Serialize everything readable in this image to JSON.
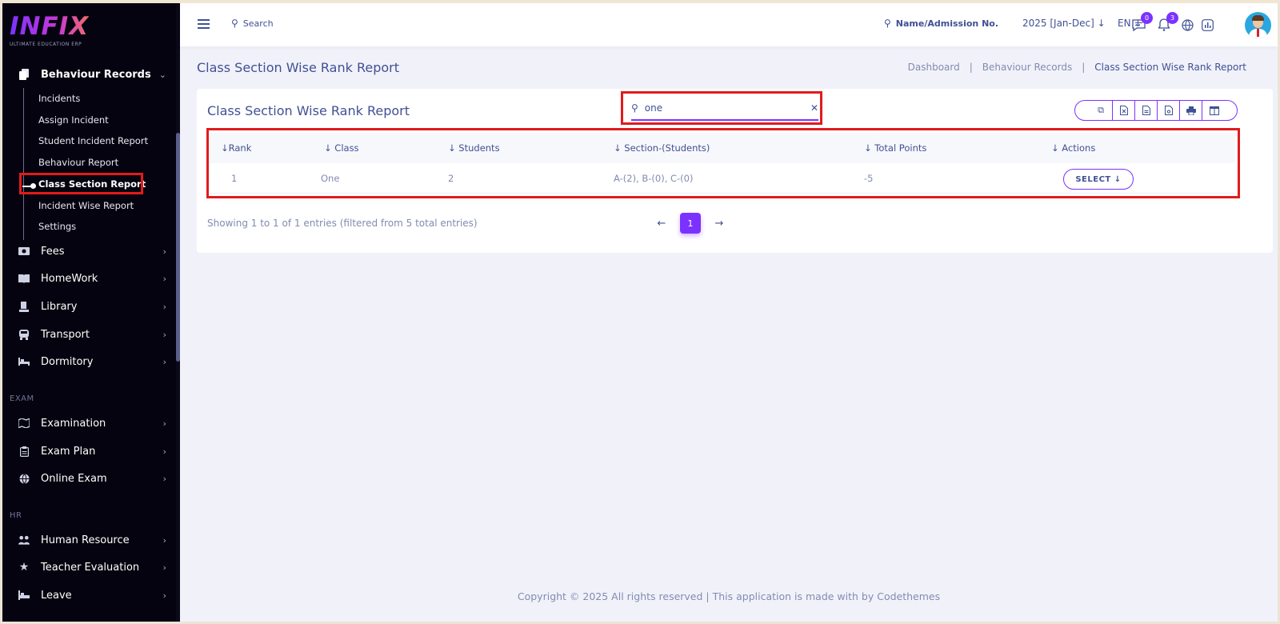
{
  "brand": {
    "logo": "INFIX",
    "tagline": "ULTIMATE EDUCATION ERP",
    "accent": "#7c32ff",
    "highlight": "#e11b1b"
  },
  "sidebar": {
    "behaviour": {
      "label": "Behaviour Records",
      "items": [
        {
          "label": "Incidents"
        },
        {
          "label": "Assign Incident"
        },
        {
          "label": "Student Incident Report"
        },
        {
          "label": "Behaviour Report"
        },
        {
          "label": "Class Section Report",
          "active": true
        },
        {
          "label": "Incident Wise Report"
        },
        {
          "label": "Settings"
        }
      ]
    },
    "menu": [
      {
        "label": "Fees",
        "icon": "money-icon"
      },
      {
        "label": "HomeWork",
        "icon": "book-icon"
      },
      {
        "label": "Library",
        "icon": "library-icon"
      },
      {
        "label": "Transport",
        "icon": "bus-icon"
      },
      {
        "label": "Dormitory",
        "icon": "bed-icon"
      }
    ],
    "exam_head": "EXAM",
    "exam_menu": [
      {
        "label": "Examination",
        "icon": "map-icon"
      },
      {
        "label": "Exam Plan",
        "icon": "clipboard-icon"
      },
      {
        "label": "Online Exam",
        "icon": "globe-icon"
      }
    ],
    "hr_head": "HR",
    "hr_menu": [
      {
        "label": "Human Resource",
        "icon": "users-icon"
      },
      {
        "label": "Teacher Evaluation",
        "icon": "star-icon"
      },
      {
        "label": "Leave",
        "icon": "leave-icon"
      }
    ]
  },
  "header": {
    "search_label": "Search",
    "name_search_label": "Name/Admission No.",
    "year": "2025 [Jan-Dec]",
    "language": "EN",
    "chat_count": "0",
    "notification_count": "3"
  },
  "page": {
    "title": "Class Section Wise Rank Report",
    "breadcrumb": [
      "Dashboard",
      "Behaviour Records",
      "Class Section Wise Rank Report"
    ]
  },
  "card": {
    "title": "Class Section Wise Rank Report",
    "search_value": "one",
    "columns": [
      "Rank",
      "Class",
      "Students",
      "Section-(Students)",
      "Total Points",
      "Actions"
    ],
    "rows": [
      {
        "rank": "1",
        "class": "One",
        "students": "2",
        "sections": "A-(2), B-(0), C-(0)",
        "points": "-5",
        "action": "SELECT"
      }
    ],
    "info": "Showing 1 to 1 of 1 entries (filtered from 5 total entries)",
    "current_page": "1"
  },
  "footer": {
    "text": "Copyright © 2025 All rights reserved | This application is made with by Codethemes"
  }
}
